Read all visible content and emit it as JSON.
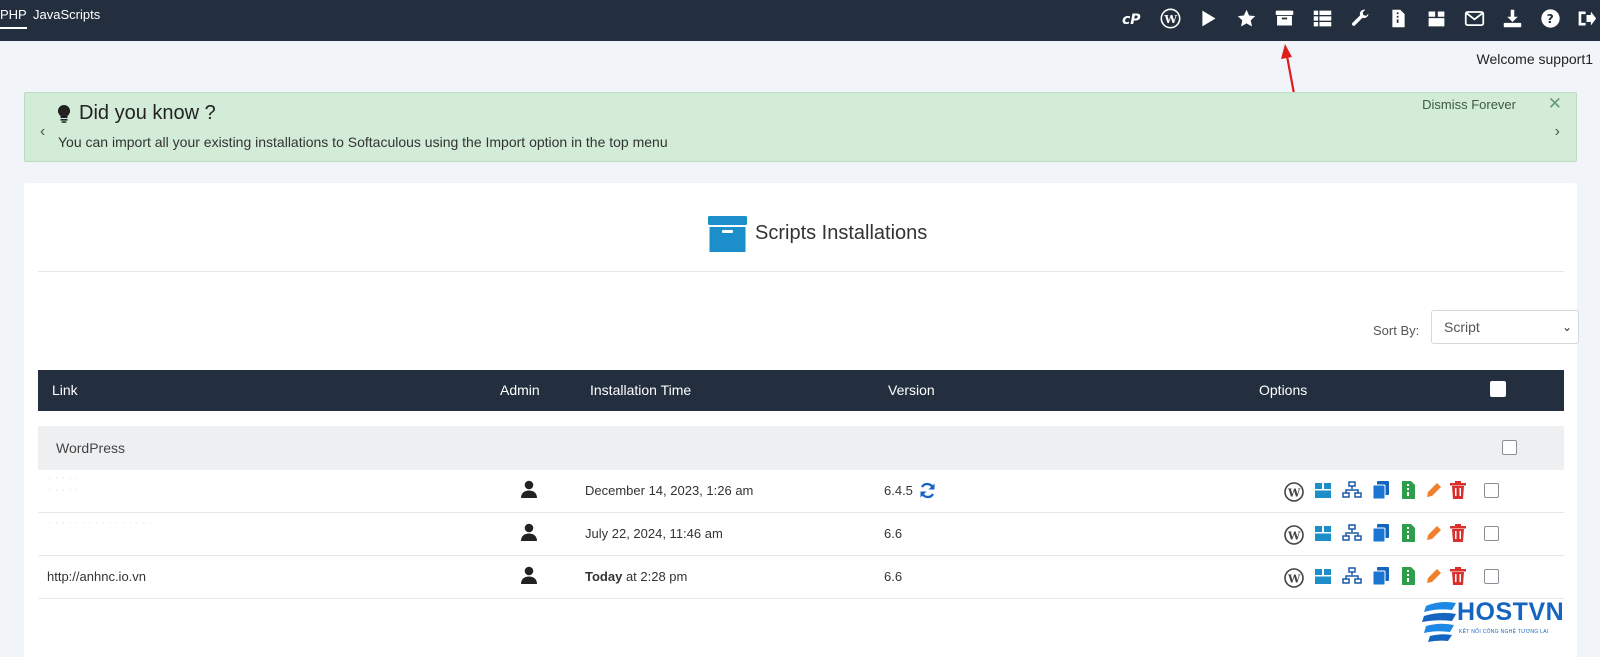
{
  "topbar": {
    "tabs": [
      {
        "label": "PHP",
        "active": true
      },
      {
        "label": "JavaScripts",
        "active": false
      }
    ],
    "icons": [
      "cpanel-icon",
      "wordpress-icon",
      "play-icon",
      "star-icon",
      "archive-icon",
      "list-icon",
      "wrench-icon",
      "file-zip-icon",
      "box-icon",
      "mail-icon",
      "download-icon",
      "help-icon",
      "logout-icon"
    ]
  },
  "welcome": "Welcome support1",
  "did_you_know": {
    "title": "Did you know ?",
    "text": "You can import all your existing installations to Softaculous using the Import option in the top menu",
    "dismiss": "Dismiss Forever",
    "close": "✕",
    "prev": "‹",
    "next": "›"
  },
  "panel": {
    "title": "Scripts Installations",
    "sort_by_label": "Sort By:",
    "sort_value": "Script",
    "columns": {
      "link": "Link",
      "admin": "Admin",
      "time": "Installation Time",
      "version": "Version",
      "options": "Options"
    },
    "group": "WordPress",
    "rows": [
      {
        "link": "",
        "time": "December 14, 2023, 1:26 am",
        "time_bold": "",
        "version": "6.4.5",
        "has_update": true
      },
      {
        "link": "",
        "time": "July 22, 2024, 11:46 am",
        "time_bold": "",
        "version": "6.6",
        "has_update": false
      },
      {
        "link": "http://anhnc.io.vn",
        "time": " at 2:28 pm",
        "time_bold": "Today",
        "version": "6.6",
        "has_update": false
      }
    ],
    "option_icons": [
      "wp-admin-icon",
      "backup-icon",
      "staging-icon",
      "clone-icon",
      "download-zip-icon",
      "edit-icon",
      "delete-icon"
    ]
  },
  "colors": {
    "topbar": "#232f3e",
    "notice_bg": "#d3ecd7",
    "accent_blue": "#1c8fcb",
    "orange": "#f0802b",
    "red": "#d9302d",
    "green": "#2e9d4c"
  },
  "watermark": {
    "name": "HOSTVN",
    "tagline": "KẾT NỐI CÔNG NGHỆ TƯƠNG LAI"
  }
}
